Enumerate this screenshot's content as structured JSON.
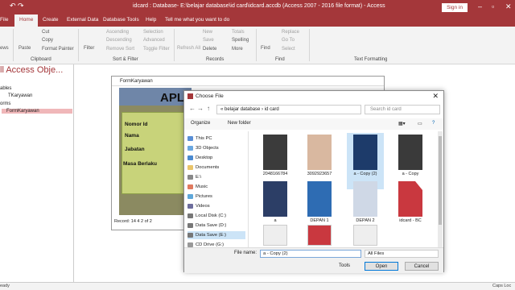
{
  "app": {
    "title": "idcard : Database- E:\\belajar database\\id card\\idcard.accdb (Access 2007 - 2016 file format) - Access",
    "signin": "Sign in",
    "tabs": [
      "File",
      "Home",
      "Create",
      "External Data",
      "Database Tools",
      "Help"
    ],
    "tell_me": "Tell me what you want to do",
    "accent": "#a4373a"
  },
  "ribbon": {
    "views": "ews",
    "clipboard": {
      "paste": "Paste",
      "cut": "Cut",
      "copy": "Copy",
      "format_painter": "Format Painter",
      "group": "Clipboard"
    },
    "sort": {
      "filter": "Filter",
      "ascending": "Ascending",
      "descending": "Descending",
      "remove_sort": "Remove Sort",
      "selection": "Selection",
      "advanced": "Advanced",
      "toggle_filter": "Toggle Filter",
      "group": "Sort & Filter"
    },
    "records": {
      "refresh": "Refresh All",
      "new": "New",
      "save": "Save",
      "delete": "Delete",
      "totals": "Totals",
      "spelling": "Spelling",
      "more": "More",
      "group": "Records"
    },
    "find": {
      "find": "Find",
      "replace": "Replace",
      "goto": "Go To",
      "select": "Select",
      "group": "Find"
    },
    "text_formatting": "Text Formatting"
  },
  "nav": {
    "header": "ll Access Obje...",
    "sections": [
      "ables",
      "orms"
    ],
    "items": [
      "TKaryawan",
      "FormKaryawan"
    ]
  },
  "form": {
    "tab": "FormKaryawan",
    "heading": "APL",
    "labels": [
      "Nomor Id",
      "Nama",
      "Jabatan",
      "Masa Berlaku"
    ],
    "record": "Record: 14  4  2 of 2"
  },
  "dialog": {
    "title": "Choose File",
    "path": [
      "«",
      "belajar database",
      "id card"
    ],
    "search_placeholder": "Search id card",
    "organize": "Organize",
    "new_folder": "New folder",
    "tree": [
      "This PC",
      "3D Objects",
      "Desktop",
      "Documents",
      "E:\\",
      "Music",
      "Pictures",
      "Videos",
      "Local Disk (C:)",
      "Data Save (D:)",
      "Data Save (E:)",
      "CD Drive (G:)"
    ],
    "files": [
      "2048166784",
      "3092923657",
      "a - Copy (2)",
      "a - Copy",
      "a",
      "DEPAN 1",
      "DEPAN 2",
      "idcard - BC"
    ],
    "filename_label": "File name:",
    "filename_value": "a - Copy (2)",
    "filetype": "All Files",
    "tools": "Tools",
    "open": "Open",
    "cancel": "Cancel"
  },
  "status": {
    "left": "eady",
    "right": "Caps Loc"
  }
}
